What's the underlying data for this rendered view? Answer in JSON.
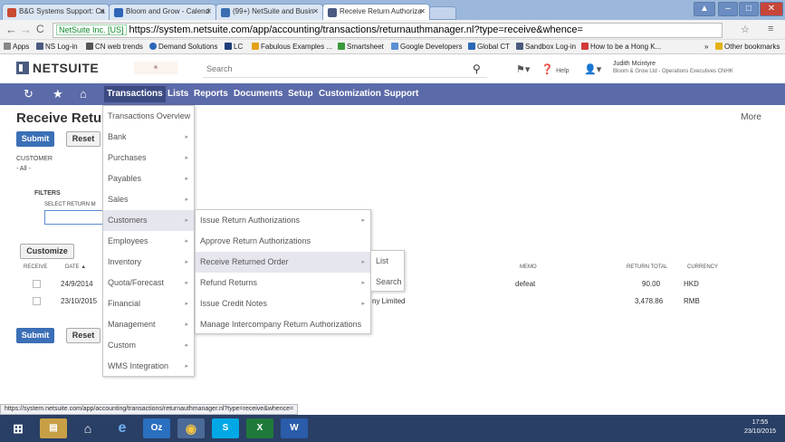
{
  "browser": {
    "tabs": [
      {
        "title": "B&G Systems Support: Ca",
        "color": "#c94a32"
      },
      {
        "title": "Bloom and Grow - Calend",
        "color": "#2e66b6"
      },
      {
        "title": "(99+) NetSuite and Busin",
        "color": "#3a6db2"
      },
      {
        "title": "Receive Return Authoriza",
        "color": "#4a5a80"
      }
    ],
    "url_site": "NetSuite Inc. [US]",
    "url": "https://system.netsuite.com/app/accounting/transactions/returnauthmanager.nl?type=receive&whence=",
    "bookmarks": [
      "Apps",
      "NS Log-in",
      "CN web trends",
      "Demand Solutions",
      "LC",
      "Fabulous Examples ...",
      "Smartsheet",
      "Google Developers",
      "Global CT",
      "Sandbox Log-in",
      "How to be a Hong K...",
      "»",
      "Other bookmarks"
    ]
  },
  "header": {
    "logo": "NETSUITE",
    "search_placeholder": "Search",
    "help": "Help",
    "user_name": "Judith Mcintyre",
    "user_role": "Bloom & Grow Ltd - Operations Executives CNHK"
  },
  "nav": {
    "items": [
      "Transactions",
      "Lists",
      "Reports",
      "Documents",
      "Setup",
      "Customization",
      "Support"
    ]
  },
  "page": {
    "title": "Receive Returr",
    "more": "More",
    "submit": "Submit",
    "reset": "Reset",
    "customer_label": "CUSTOMER",
    "customer_value": "- All -",
    "filters_label": "FILTERS",
    "select_return_label": "SELECT RETURN M",
    "customize": "Customize",
    "columns": {
      "receive": "RECEIVE",
      "date": "DATE ▲",
      "memo": "MEMO",
      "return_total": "RETURN TOTAL",
      "currency": "CURRENCY"
    },
    "rows": [
      {
        "date": "24/9/2014",
        "name": "",
        "memo": "defeat",
        "total": "90.00",
        "currency": "HKD"
      },
      {
        "date": "23/10/2015",
        "name": "ny Limited",
        "memo": "",
        "total": "3,478.86",
        "currency": "RMB"
      }
    ]
  },
  "menus": {
    "transactions": [
      "Transactions Overview",
      "Bank",
      "Purchases",
      "Payables",
      "Sales",
      "Customers",
      "Employees",
      "Inventory",
      "Quota/Forecast",
      "Financial",
      "Management",
      "Custom",
      "WMS Integration"
    ],
    "customers": [
      "Issue Return Authorizations",
      "Approve Return Authorizations",
      "Receive Returned Order",
      "Refund Returns",
      "Issue Credit Notes",
      "Manage Intercompany Return Authorizations"
    ],
    "receive": [
      "List",
      "Search"
    ]
  },
  "status_url": "https://system.netsuite.com/app/accounting/transactions/returnauthmanager.nl?type=receive&whence=",
  "clock": {
    "time": "17:55",
    "date": "23/10/2015"
  }
}
